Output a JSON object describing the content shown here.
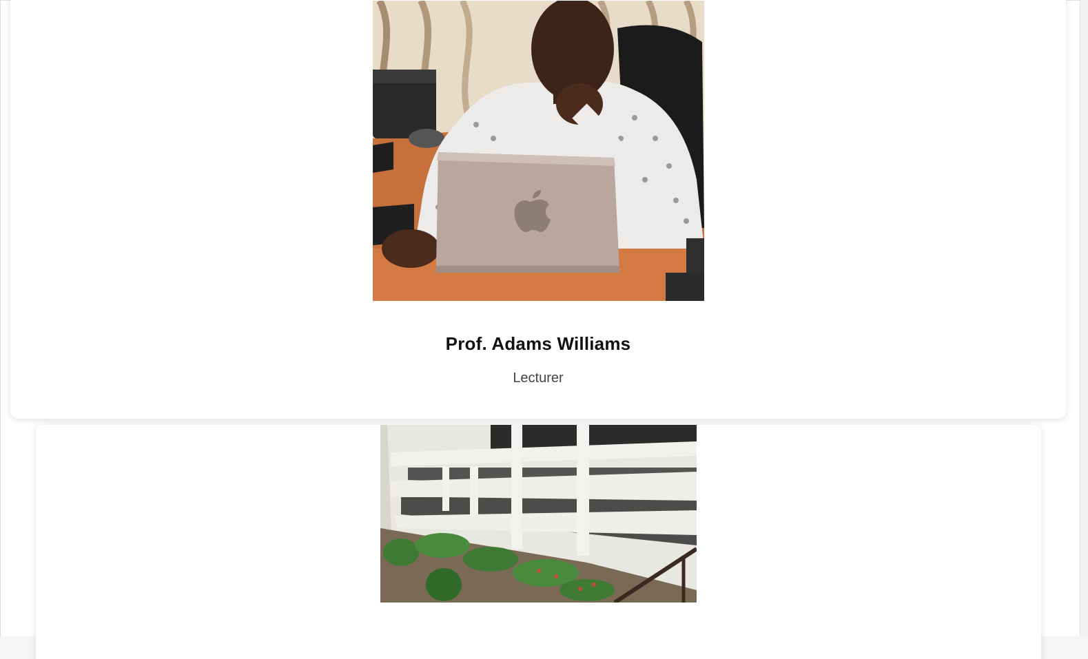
{
  "profile": {
    "name": "Prof. Adams Williams",
    "role": "Lecturer"
  },
  "colors": {
    "name_text": "#111111",
    "role_text": "#444444",
    "card_background": "#ffffff",
    "page_background": "#ffffff"
  },
  "icons": {
    "laptop_logo": "apple-logo-icon"
  }
}
